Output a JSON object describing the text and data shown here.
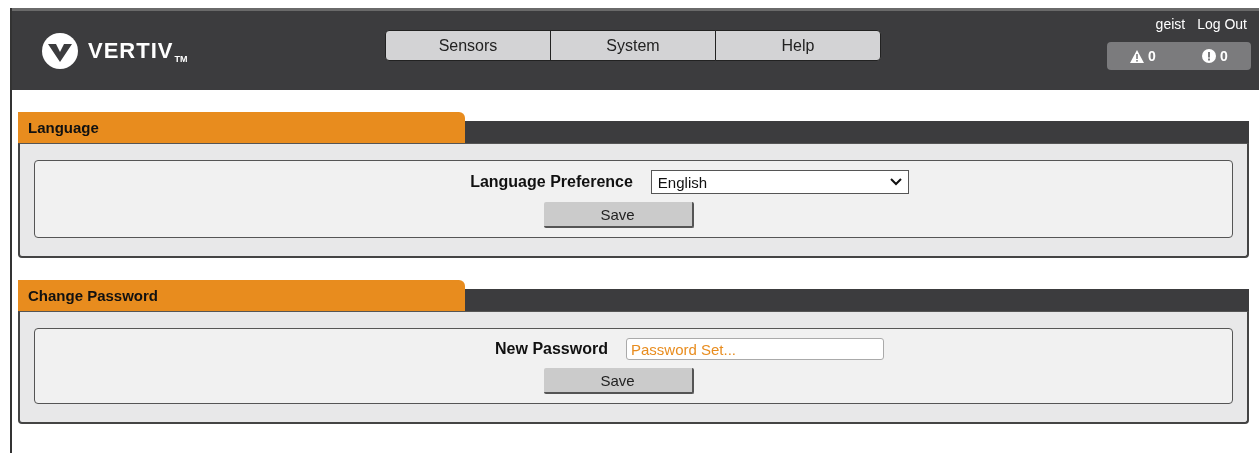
{
  "header": {
    "logo": "VERTIV",
    "logo_mark": "TM",
    "nav": [
      {
        "label": "Sensors"
      },
      {
        "label": "System"
      },
      {
        "label": "Help"
      }
    ],
    "user": "geist",
    "logout": "Log Out",
    "alarms": [
      {
        "kind": "warning",
        "count": "0"
      },
      {
        "kind": "alert",
        "count": "0"
      }
    ]
  },
  "sections": [
    {
      "title": "Language",
      "field": {
        "kind": "select",
        "label": "Language Preference",
        "value": "English"
      },
      "button": "Save"
    },
    {
      "title": "Change Password",
      "field": {
        "kind": "password",
        "label": "New Password",
        "placeholder": "Password Set..."
      },
      "button": "Save"
    }
  ]
}
